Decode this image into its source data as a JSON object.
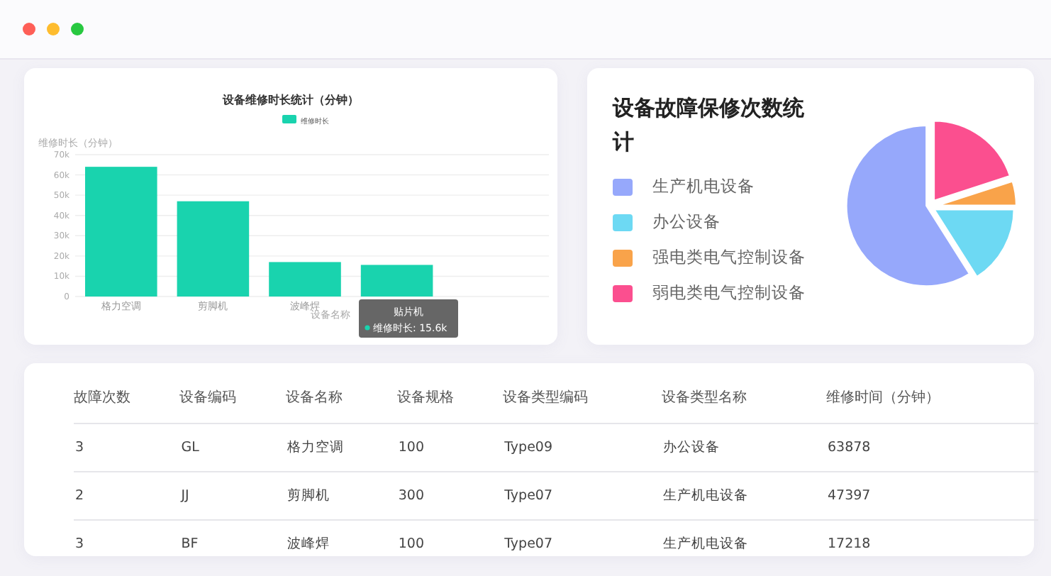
{
  "bar_card": {
    "chart_data": {
      "type": "bar",
      "title": "设备维修时长统计（分钟）",
      "xlabel": "设备名称",
      "ylabel": "维修时长（分钟）",
      "categories": [
        "格力空调",
        "剪脚机",
        "波峰焊",
        "贴片机"
      ],
      "series": [
        {
          "name": "维修时长",
          "color": "#19d3ae",
          "values": [
            64000,
            47000,
            17000,
            15600
          ]
        }
      ],
      "grid": true,
      "ylim": [
        0,
        70000
      ],
      "yticks": [
        {
          "value": 0,
          "label": "0"
        },
        {
          "value": 10000,
          "label": "10k"
        },
        {
          "value": 20000,
          "label": "20k"
        },
        {
          "value": 30000,
          "label": "30k"
        },
        {
          "value": 40000,
          "label": "40k"
        },
        {
          "value": 50000,
          "label": "50k"
        },
        {
          "value": 60000,
          "label": "60k"
        },
        {
          "value": 70000,
          "label": "70k"
        }
      ]
    },
    "tooltip": {
      "text": "维修时长: 15.6k"
    }
  },
  "pie_card": {
    "title": "设备故障保修次数统计",
    "legend": [
      {
        "label": "生产机电设备",
        "color": "#96a8fb"
      },
      {
        "label": "办公设备",
        "color": "#6dd9f3"
      },
      {
        "label": "强电类电气控制设备",
        "color": "#f9a34a"
      },
      {
        "label": "弱电类电气控制设备",
        "color": "#fb4f8f"
      }
    ]
  },
  "table": {
    "columns": [
      "故障次数",
      "设备编码",
      "设备名称",
      "设备规格",
      "设备类型编码",
      "设备类型名称",
      "维修时间（分钟）"
    ],
    "rows": [
      [
        "3",
        "GL",
        "格力空调",
        "100",
        "Type09",
        "办公设备",
        "63878"
      ],
      [
        "2",
        "JJ",
        "剪脚机",
        "300",
        "Type07",
        "生产机电设备",
        "47397"
      ],
      [
        "3",
        "BF",
        "波峰焊",
        "100",
        "Type07",
        "生产机电设备",
        "17218"
      ]
    ]
  }
}
